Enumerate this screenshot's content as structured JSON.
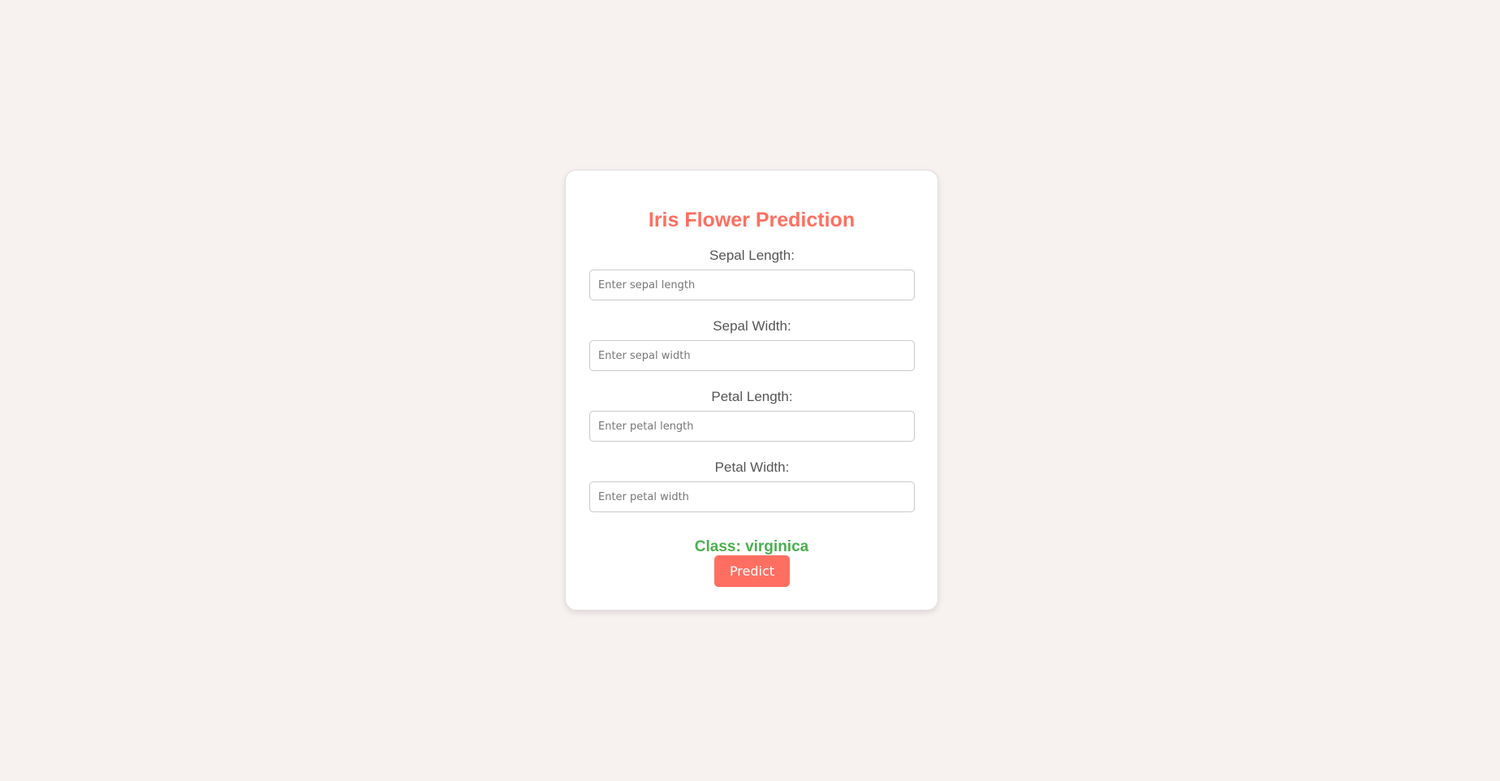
{
  "form": {
    "title": "Iris Flower Prediction",
    "fields": [
      {
        "label": "Sepal Length:",
        "placeholder": "Enter sepal length",
        "value": ""
      },
      {
        "label": "Sepal Width:",
        "placeholder": "Enter sepal width",
        "value": ""
      },
      {
        "label": "Petal Length:",
        "placeholder": "Enter petal length",
        "value": ""
      },
      {
        "label": "Petal Width:",
        "placeholder": "Enter petal width",
        "value": ""
      }
    ],
    "result": "Class: virginica",
    "submit_label": "Predict"
  },
  "colors": {
    "background": "#f7f1f0",
    "accent": "#ff6f61",
    "result": "#4caf50"
  }
}
